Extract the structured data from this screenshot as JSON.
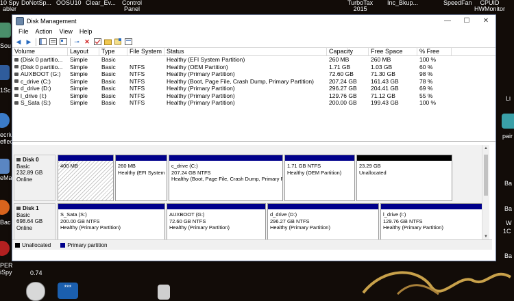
{
  "desktop": {
    "top_labels": [
      {
        "line1": "10 Spy",
        "line2": "abler"
      },
      {
        "line1": "DoNotSp...",
        "line2": ""
      },
      {
        "line1": "OOSU10",
        "line2": ""
      },
      {
        "line1": "Clear_Ev...",
        "line2": ""
      },
      {
        "line1": "Control",
        "line2": "Panel"
      },
      {
        "line1": "TurboTax",
        "line2": "2015"
      },
      {
        "line1": "Inc_Bkup...",
        "line2": ""
      },
      {
        "line1": "SpeedFan",
        "line2": ""
      },
      {
        "line1": "CPUID",
        "line2": "HWMonitor"
      }
    ],
    "left_labels": [
      "Sou",
      "1Sc",
      "ecriu",
      "eflect",
      "eMa",
      "Bac",
      "PER",
      "iSpy"
    ],
    "right_labels": [
      "Li",
      "pair",
      "Ba",
      "Ba",
      "W",
      "1C",
      "Ba"
    ],
    "bottom_value": "0.74",
    "password_icon_text": "***",
    "accent": "#c8a14a"
  },
  "window": {
    "title": "Disk Management",
    "controls": {
      "minimize": "—",
      "maximize": "☐",
      "close": "✕"
    },
    "menu": [
      "File",
      "Action",
      "View",
      "Help"
    ],
    "toolbar_icons": [
      "back-icon",
      "forward-icon",
      "console-tree-icon",
      "help-icon",
      "properties-icon",
      "connect-icon",
      "delete-icon",
      "check-icon",
      "folder-icon",
      "new-volume-icon",
      "settings-icon"
    ]
  },
  "table": {
    "columns": [
      "Volume",
      "Layout",
      "Type",
      "File System",
      "Status",
      "Capacity",
      "Free Space",
      "% Free"
    ],
    "rows": [
      [
        "(Disk 0 partitio...",
        "Simple",
        "Basic",
        "",
        "Healthy (EFI System Partition)",
        "260 MB",
        "260 MB",
        "100 %"
      ],
      [
        "(Disk 0 partitio...",
        "Simple",
        "Basic",
        "NTFS",
        "Healthy (OEM Partition)",
        "1.71 GB",
        "1.03 GB",
        "60 %"
      ],
      [
        "AUXBOOT (G:)",
        "Simple",
        "Basic",
        "NTFS",
        "Healthy (Primary Partition)",
        "72.60 GB",
        "71.30 GB",
        "98 %"
      ],
      [
        "c_drive (C:)",
        "Simple",
        "Basic",
        "NTFS",
        "Healthy (Boot, Page File, Crash Dump, Primary Partition)",
        "207.24 GB",
        "161.43 GB",
        "78 %"
      ],
      [
        "d_drive (D:)",
        "Simple",
        "Basic",
        "NTFS",
        "Healthy (Primary Partition)",
        "296.27 GB",
        "204.41 GB",
        "69 %"
      ],
      [
        "l_drive (I:)",
        "Simple",
        "Basic",
        "NTFS",
        "Healthy (Primary Partition)",
        "129.76 GB",
        "71.12 GB",
        "55 %"
      ],
      [
        "S_Sata (S:)",
        "Simple",
        "Basic",
        "NTFS",
        "Healthy (Primary Partition)",
        "200.00 GB",
        "199.43 GB",
        "100 %"
      ]
    ]
  },
  "disks": [
    {
      "name": "Disk 0",
      "type": "Basic",
      "size": "232.89 GB",
      "status": "Online",
      "partitions": [
        {
          "name": "",
          "size": "400 MB",
          "status": "",
          "style": "hatch"
        },
        {
          "name": "",
          "size": "260 MB",
          "status": "Healthy (EFI System",
          "style": "primary"
        },
        {
          "name": "c_drive  (C:)",
          "size": "207.24 GB NTFS",
          "status": "Healthy (Boot, Page File, Crash Dump, Primary Pa",
          "style": "primary"
        },
        {
          "name": "",
          "size": "1.71 GB NTFS",
          "status": "Healthy (OEM Partition)",
          "style": "primary"
        },
        {
          "name": "",
          "size": "23.29 GB",
          "status": "Unallocated",
          "style": "unalloc"
        }
      ]
    },
    {
      "name": "Disk 1",
      "type": "Basic",
      "size": "698.64 GB",
      "status": "Online",
      "partitions": [
        {
          "name": "S_Sata  (S:)",
          "size": "200.00 GB NTFS",
          "status": "Healthy (Primary Partition)",
          "style": "primary"
        },
        {
          "name": "AUXBOOT  (G:)",
          "size": "72.60 GB NTFS",
          "status": "Healthy (Primary Partition)",
          "style": "primary"
        },
        {
          "name": "d_drive  (D:)",
          "size": "296.27 GB NTFS",
          "status": "Healthy (Primary Partition)",
          "style": "primary"
        },
        {
          "name": "l_drive  (I:)",
          "size": "129.76 GB NTFS",
          "status": "Healthy (Primary Partition)",
          "style": "primary"
        }
      ]
    }
  ],
  "legend": [
    {
      "label": "Unallocated",
      "color": "#000000"
    },
    {
      "label": "Primary partition",
      "color": "#00008b"
    }
  ]
}
